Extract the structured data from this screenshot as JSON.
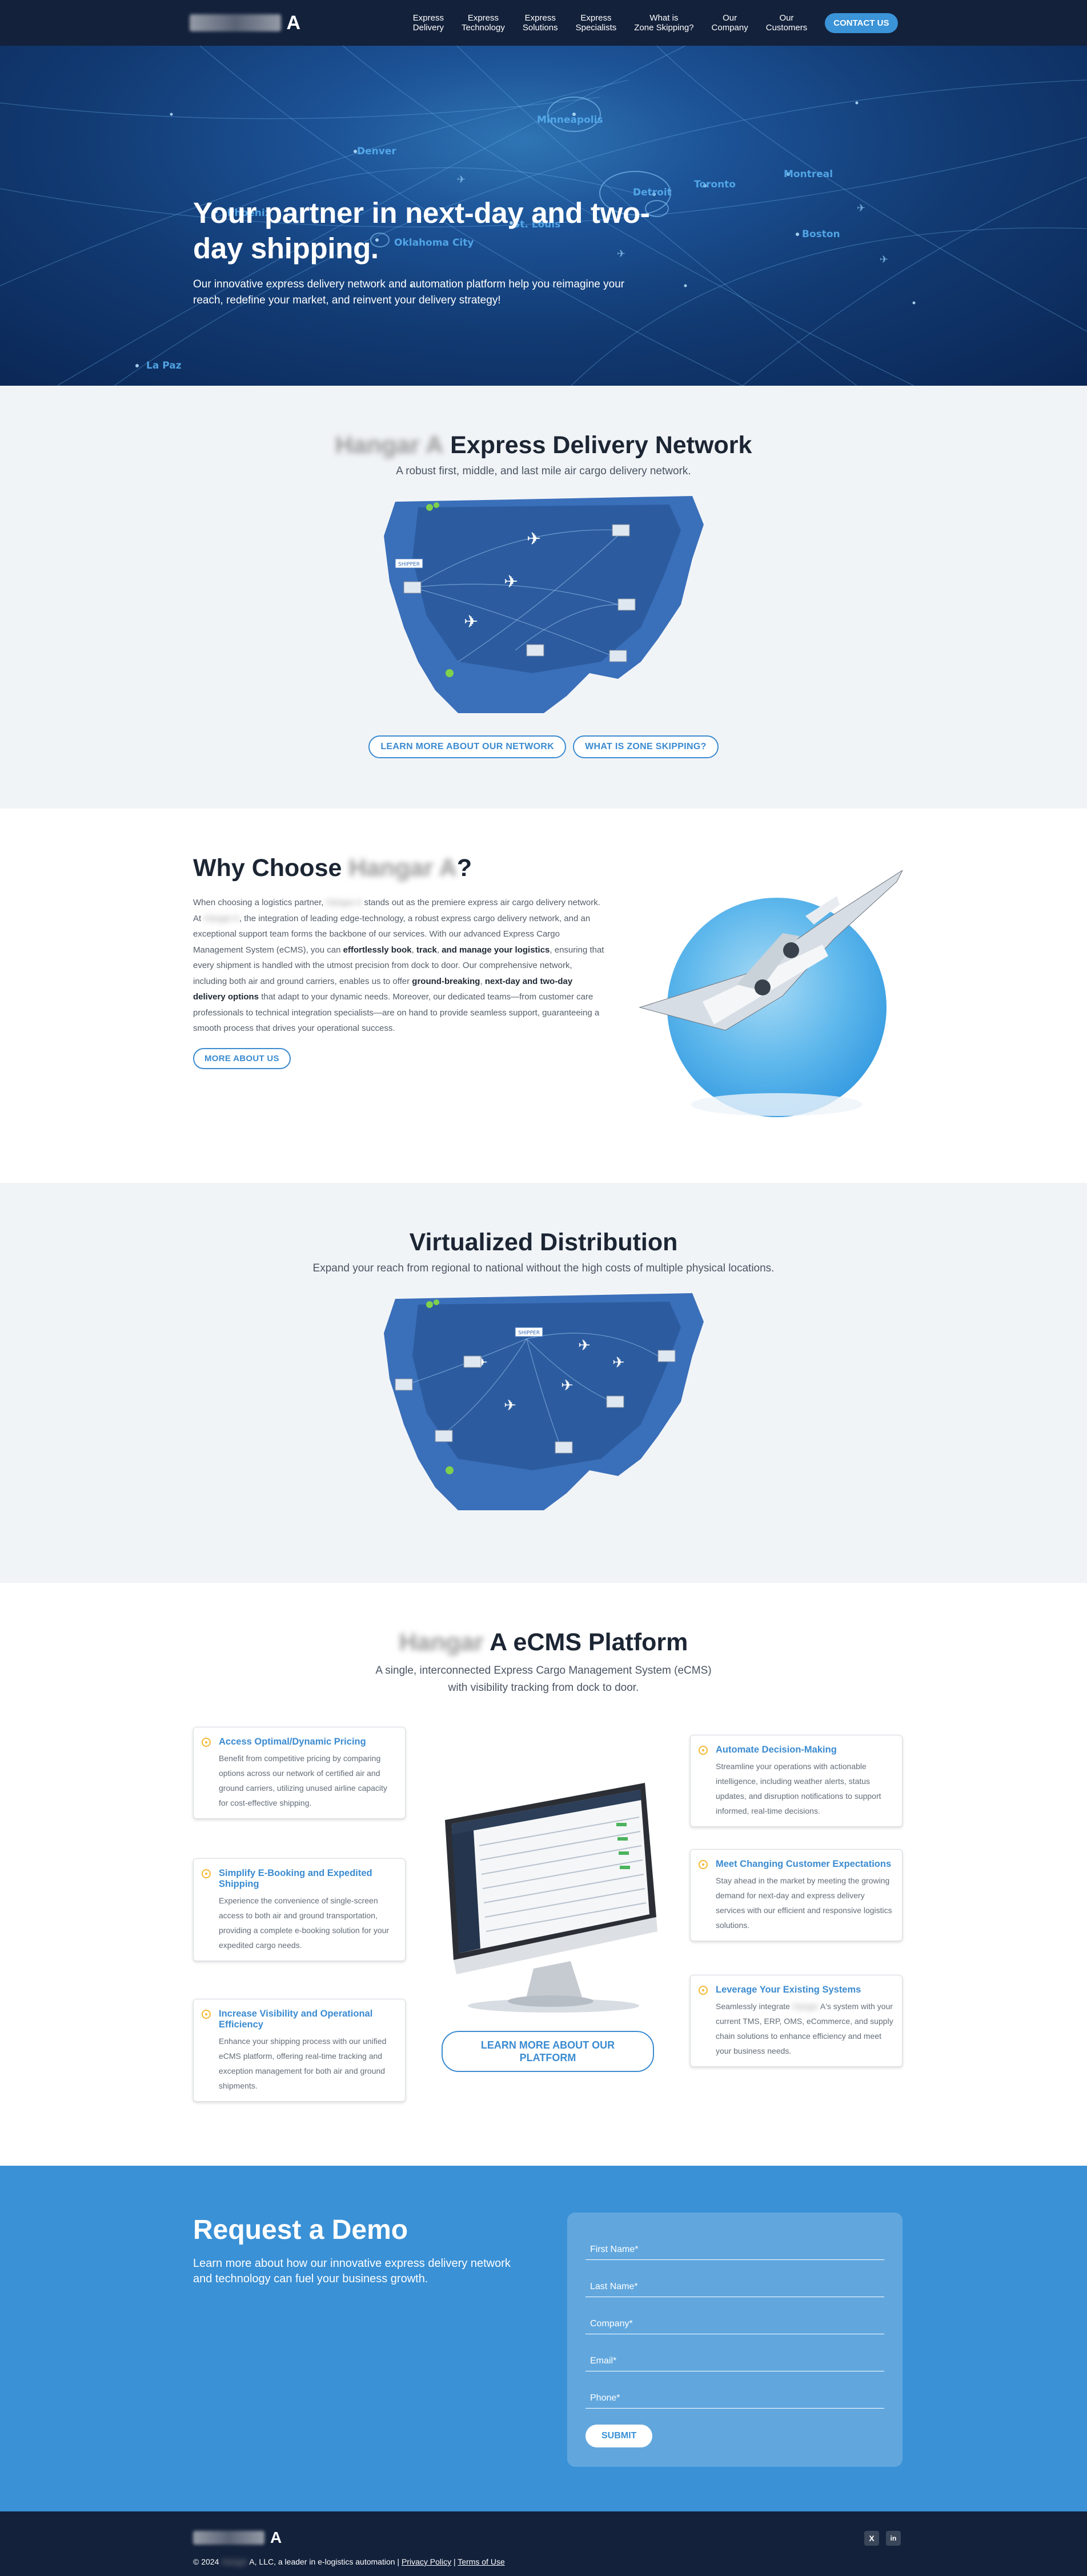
{
  "nav": {
    "logo_mark": "A",
    "links": [
      "Express\nDelivery",
      "Express\nTechnology",
      "Express\nSolutions",
      "Express\nSpecialists",
      "What is\nZone Skipping?",
      "Our\nCompany",
      "Our\nCustomers"
    ],
    "cta": "CONTACT US"
  },
  "hero": {
    "title": "Your partner in next-day and two-day shipping.",
    "body": "Our innovative express delivery network and automation platform help you reimagine your reach, redefine your market, and reinvent your delivery strategy!",
    "cities": [
      "Denver",
      "Minneapolis",
      "Phoenix",
      "Oklahoma City",
      "St. Louis",
      "Detroit",
      "Toronto",
      "Montreal",
      "Boston",
      "La Paz"
    ]
  },
  "network": {
    "title_blur": "Hangar A",
    "title": "Express Delivery Network",
    "subtitle": "A robust first, middle, and last mile air cargo delivery network.",
    "map_tag": "SHIPPER",
    "btn1": "LEARN MORE ABOUT OUR NETWORK",
    "btn2": "WHAT IS ZONE SKIPPING?"
  },
  "why": {
    "title_pre": "Why Choose ",
    "title_blur": "Hangar A",
    "title_post": "?",
    "p1": "When choosing a logistics partner, ",
    "p1_blur": "Hangar A",
    "p2": " stands out as the premiere express air cargo delivery network. At ",
    "p2_blur": "Hangar A",
    "p3": ", the integration of leading edge-technology, a robust express cargo delivery network, and an exceptional support team forms the backbone of our services. With our advanced Express Cargo Management System (eCMS), you can ",
    "b1": "effortlessly book",
    "c1": ", ",
    "b2": "track",
    "c2": ", ",
    "b3": "and manage your logistics",
    "p4": ", ensuring that every shipment is handled with the utmost precision from dock to door. Our comprehensive network, including both air and ground carriers, enables us to offer ",
    "b4": "ground-breaking",
    "c3": ", ",
    "b5": "next-day and two-day delivery options",
    "p5": " that adapt to your dynamic needs. Moreover, our dedicated teams—from customer care professionals to technical integration specialists—are on hand to provide seamless support, guaranteeing a smooth process that drives your operational success.",
    "btn": "MORE ABOUT US"
  },
  "virtual": {
    "title": "Virtualized Distribution",
    "subtitle": "Expand your reach from regional to national without the high costs of multiple physical locations.",
    "map_tag": "SHIPPER"
  },
  "ecms": {
    "title_blur": "Hangar",
    "title": " A eCMS Platform",
    "subtitle1": "A single, interconnected Express Cargo Management System (eCMS)",
    "subtitle2": "with visibility tracking from dock to door.",
    "cards": [
      {
        "title": "Access Optimal/Dynamic Pricing",
        "body": "Benefit from competitive pricing by comparing options across our network of certified air and ground carriers, utilizing unused airline capacity for cost-effective shipping."
      },
      {
        "title": "Simplify E-Booking and Expedited Shipping",
        "body": "Experience the convenience of single-screen access to both air and ground transportation, providing a complete e-booking solution for your expedited cargo needs."
      },
      {
        "title": "Increase Visibility and Operational Efficiency",
        "body": "Enhance your shipping process with our unified eCMS platform, offering real-time tracking and exception management for both air and ground shipments."
      },
      {
        "title": "Automate Decision-Making",
        "body": "Streamline your operations with actionable intelligence, including weather alerts, status updates, and disruption notifications to support informed, real-time decisions."
      },
      {
        "title": "Meet Changing Customer Expectations",
        "body": "Stay ahead in the market by meeting the growing demand for next-day and express delivery services with our efficient and responsive logistics solutions."
      },
      {
        "title": "Leverage Your Existing Systems",
        "body_pre": "Seamlessly integrate ",
        "body_blur": "Hangar",
        "body": " A's system with your current TMS, ERP, OMS, eCommerce, and supply chain solutions to enhance efficiency and meet your business needs."
      }
    ],
    "btn": "LEARN MORE ABOUT OUR PLATFORM"
  },
  "demo": {
    "title": "Request a Demo",
    "lead": "Learn more about how our innovative express delivery network and technology can fuel your business growth.",
    "fields": [
      "First Name*",
      "Last Name*",
      "Company*",
      "Email*",
      "Phone*"
    ],
    "submit": "SUBMIT"
  },
  "footer": {
    "copy_pre": "© 2024 ",
    "copy_blur": "Hangar",
    "copy_post": " A, LLC, a leader in e-logistics automation | ",
    "privacy": "Privacy Policy",
    "sep": " | ",
    "terms": "Terms of Use",
    "social": [
      "X",
      "in"
    ]
  }
}
